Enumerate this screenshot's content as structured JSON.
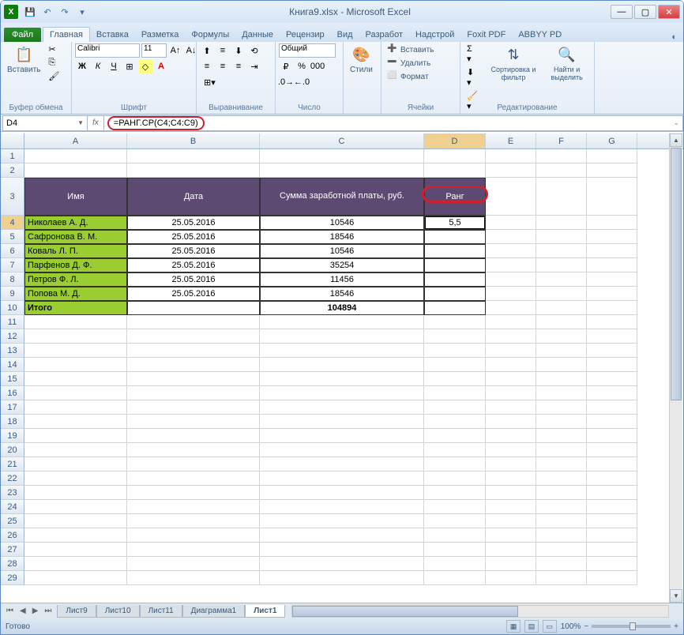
{
  "title": "Книга9.xlsx - Microsoft Excel",
  "qat": {
    "save": "💾",
    "undo": "↶",
    "redo": "↷"
  },
  "ribbon": {
    "file": "Файл",
    "tabs": [
      "Главная",
      "Вставка",
      "Разметка",
      "Формулы",
      "Данные",
      "Рецензир",
      "Вид",
      "Разработ",
      "Надстрой",
      "Foxit PDF",
      "ABBYY PD"
    ],
    "active_tab": 0,
    "groups": {
      "clipboard": {
        "label": "Буфер обмена",
        "paste": "Вставить"
      },
      "font": {
        "label": "Шрифт",
        "name": "Calibri",
        "size": "11"
      },
      "align": {
        "label": "Выравнивание"
      },
      "number": {
        "label": "Число",
        "format": "Общий"
      },
      "styles": {
        "label": "Стили",
        "btn": "Стили"
      },
      "cells": {
        "label": "Ячейки",
        "insert": "Вставить",
        "delete": "Удалить",
        "format": "Формат"
      },
      "editing": {
        "label": "Редактирование",
        "sort": "Сортировка и фильтр",
        "find": "Найти и выделить"
      }
    }
  },
  "namebox": "D4",
  "formula": "=РАНГ.СР(C4;C4:C9)",
  "columns": [
    "A",
    "B",
    "C",
    "D",
    "E",
    "F",
    "G"
  ],
  "col_widths": [
    "cw-A",
    "cw-B",
    "cw-C",
    "cw-D",
    "cw-E",
    "cw-F",
    "cw-G"
  ],
  "selected_col": "D",
  "selected_row": 4,
  "chart_data": {
    "type": "table",
    "headers": [
      "Имя",
      "Дата",
      "Сумма заработной платы, руб.",
      "Ранг"
    ],
    "rows": [
      [
        "Николаев А. Д.",
        "25.05.2016",
        "10546",
        "5,5"
      ],
      [
        "Сафронова В. М.",
        "25.05.2016",
        "18546",
        ""
      ],
      [
        "Коваль Л. П.",
        "25.05.2016",
        "10546",
        ""
      ],
      [
        "Парфенов Д. Ф.",
        "25.05.2016",
        "35254",
        ""
      ],
      [
        "Петров Ф. Л.",
        "25.05.2016",
        "11456",
        ""
      ],
      [
        "Попова М. Д.",
        "25.05.2016",
        "18546",
        ""
      ]
    ],
    "total": {
      "label": "Итого",
      "value": "104894"
    }
  },
  "sheet_tabs": [
    "Лист9",
    "Лист10",
    "Лист11",
    "Диаграмма1",
    "Лист1"
  ],
  "active_sheet": 4,
  "status": "Готово",
  "zoom": "100%"
}
